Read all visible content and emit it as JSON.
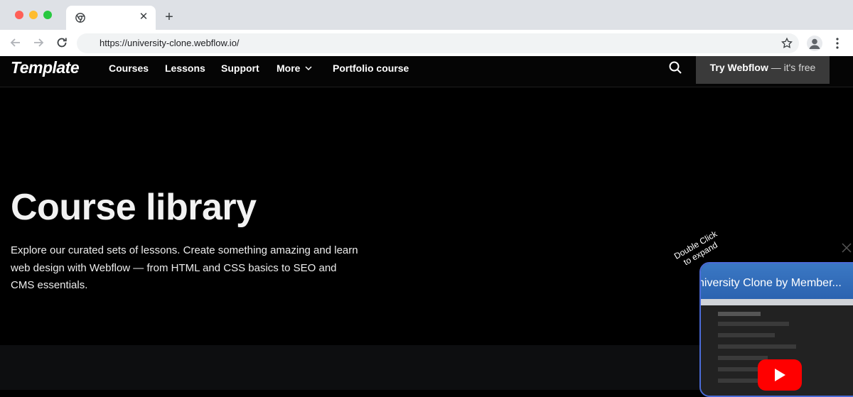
{
  "browser": {
    "url": "https://university-clone.webflow.io/",
    "tab_close_glyph": "✕",
    "new_tab_glyph": "+",
    "icons": [
      "chrome-favicon-icon",
      "back-arrow-icon",
      "forward-arrow-icon",
      "reload-icon",
      "star-icon",
      "profile-icon",
      "kebab-menu-icon"
    ]
  },
  "nav": {
    "logo": "Template",
    "links": {
      "courses": "Courses",
      "lessons": "Lessons",
      "support": "Support",
      "more": "More",
      "portfolio": "Portfolio course"
    },
    "cta_bold": "Try Webflow",
    "cta_rest": " — it's free"
  },
  "hero": {
    "title": "Course library",
    "description": "Explore our curated sets of lessons. Create something amazing and learn web design with Webflow — from HTML and CSS basics to SEO and CMS essentials."
  },
  "video": {
    "hint_line1": "Double Click",
    "hint_line2": "to expand",
    "title": "niversity Clone by Member..."
  },
  "colors": {
    "page_bg": "#000000",
    "cta_bg": "#3a3a3a",
    "video_border": "#4b6bd8",
    "play_red": "#ff0000"
  }
}
